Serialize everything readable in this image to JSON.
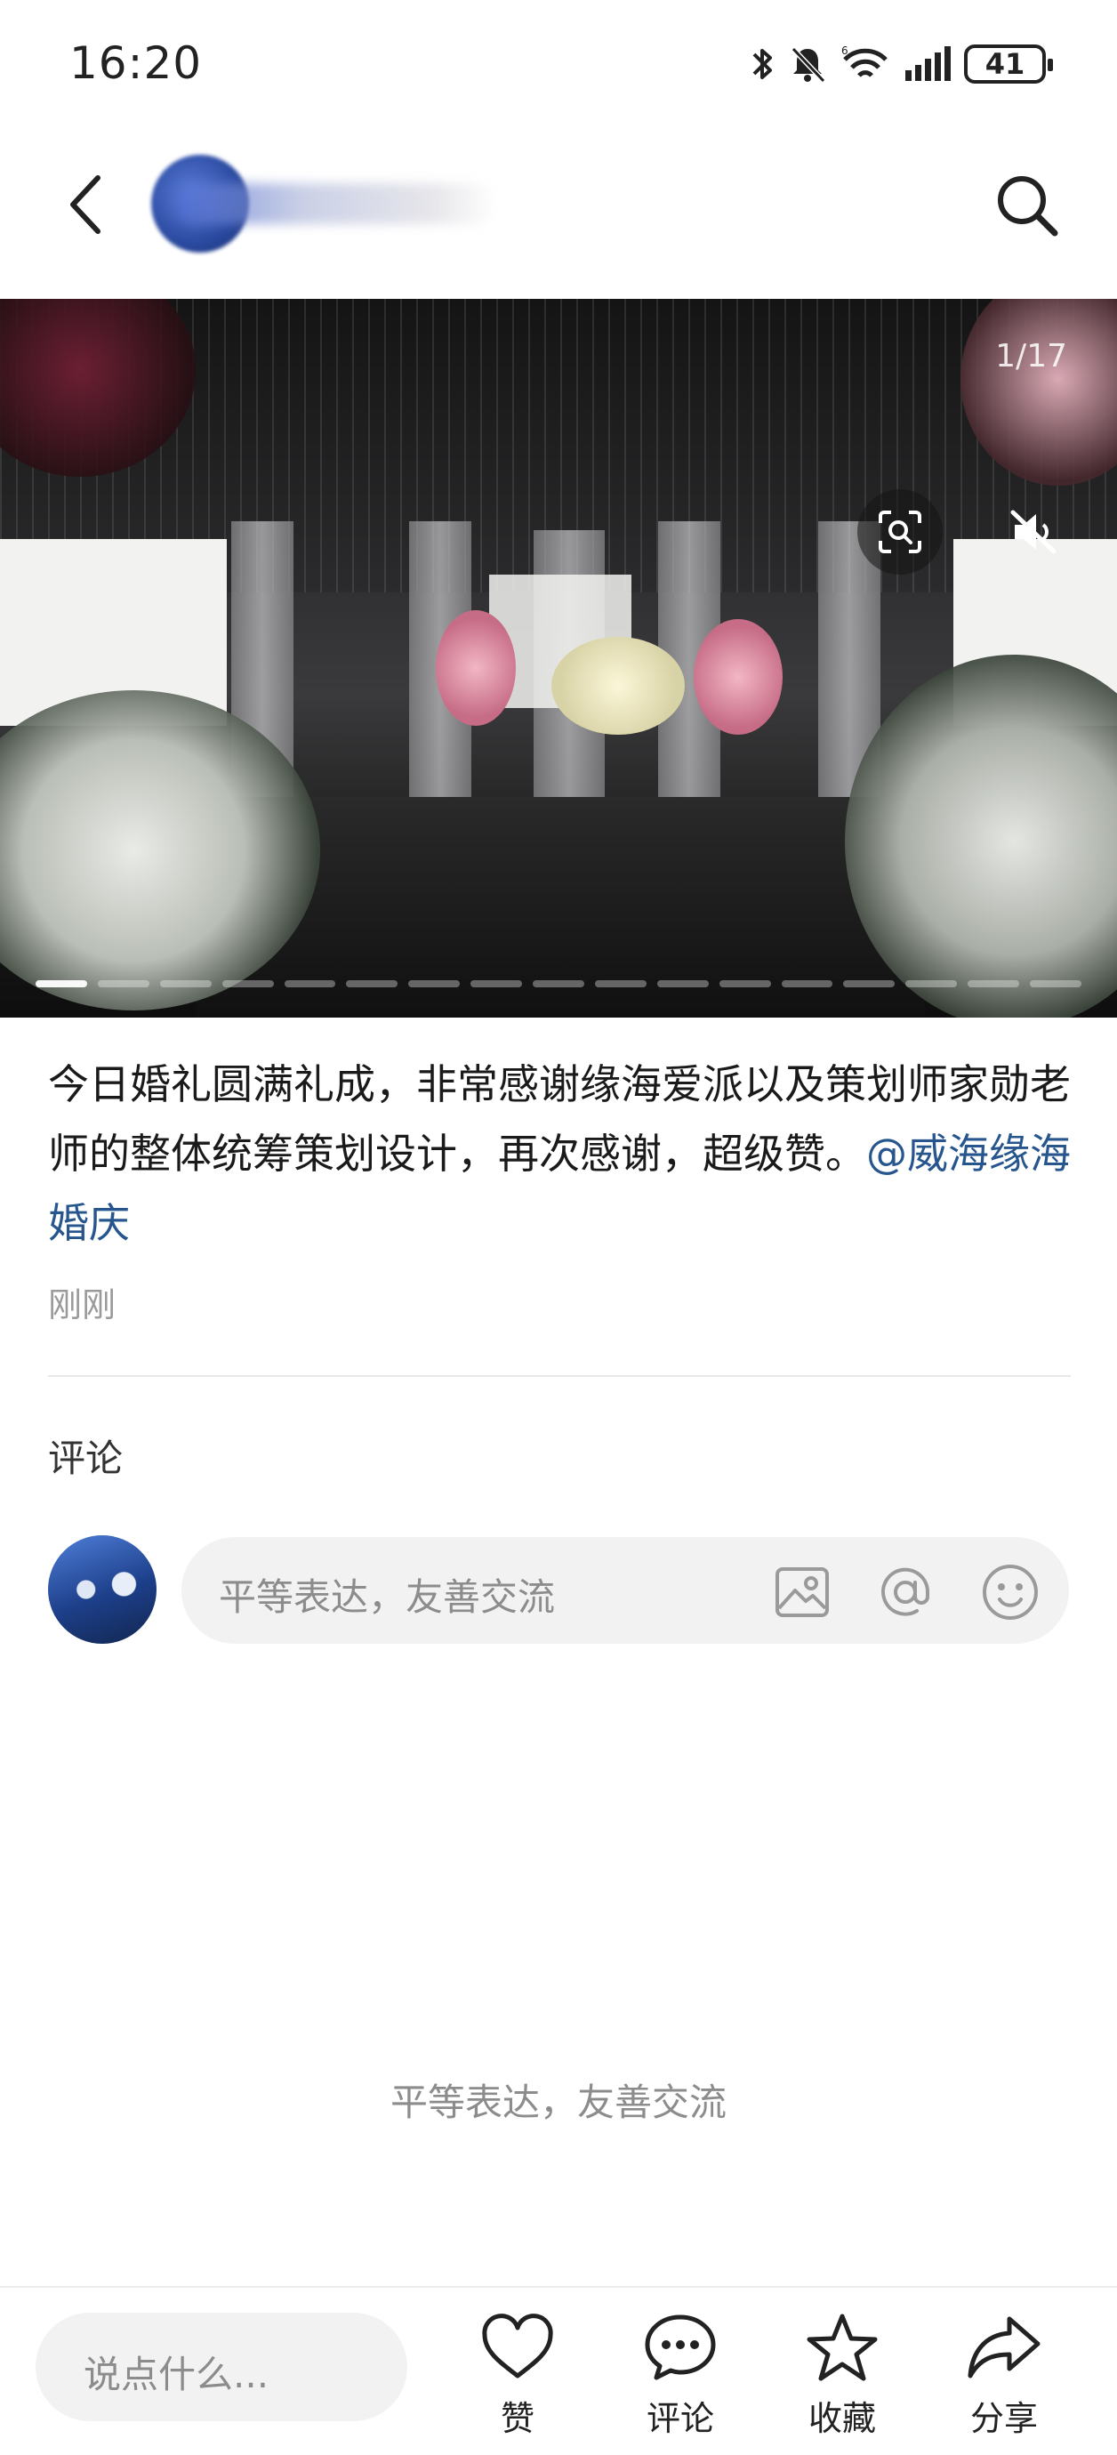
{
  "status_bar": {
    "time": "16:20",
    "battery": "41",
    "icons": [
      "bluetooth-icon",
      "mute-icon",
      "wifi-icon",
      "signal-icon",
      "battery-icon"
    ]
  },
  "header": {
    "back_icon": "chevron-left-icon",
    "search_icon": "search-icon"
  },
  "media": {
    "counter": "1/17",
    "page_count": 17,
    "current_page": 1,
    "scan_icon": "scan-icon",
    "mute_icon": "speaker-muted-icon"
  },
  "post": {
    "text": "今日婚礼圆满礼成，非常感谢缘海爱派以及策划师家勋老师的整体统筹策划设计，再次感谢，超级赞。",
    "mention": "@威海缘海婚庆",
    "time": "刚刚"
  },
  "comments": {
    "title": "评论",
    "input_placeholder": "平等表达，友善交流",
    "input_icons": [
      "image-icon",
      "at-icon",
      "emoji-icon"
    ],
    "empty_hint": "平等表达，友善交流"
  },
  "bottom_bar": {
    "input_placeholder": "说点什么...",
    "actions": [
      {
        "label": "赞",
        "icon": "heart-icon"
      },
      {
        "label": "评论",
        "icon": "comment-icon"
      },
      {
        "label": "收藏",
        "icon": "star-icon"
      },
      {
        "label": "分享",
        "icon": "share-icon"
      }
    ]
  },
  "colors": {
    "mention": "#27568f",
    "placeholder": "#8c8c8c",
    "input_bg": "#f2f2f2"
  }
}
